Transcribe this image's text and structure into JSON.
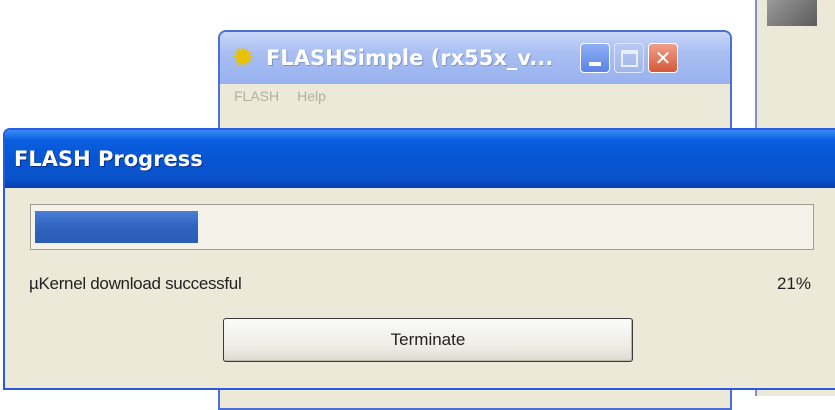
{
  "background_window": {
    "title": "FLASHSimple (rx55x_v...",
    "app_icon": "sparkle-icon",
    "menu": [
      {
        "label": "FLASH"
      },
      {
        "label": "Help"
      }
    ]
  },
  "dialog": {
    "title": "FLASH Progress",
    "progress": {
      "percent_label": "21%",
      "fill_fraction": 0.21,
      "fill_color": "#2f63bf"
    },
    "status": "µKernel download successful",
    "terminate_label": "Terminate"
  },
  "colors": {
    "title_bar": "#0755d4",
    "window_face": "#ece9d8",
    "close_button": "#d6573a"
  }
}
